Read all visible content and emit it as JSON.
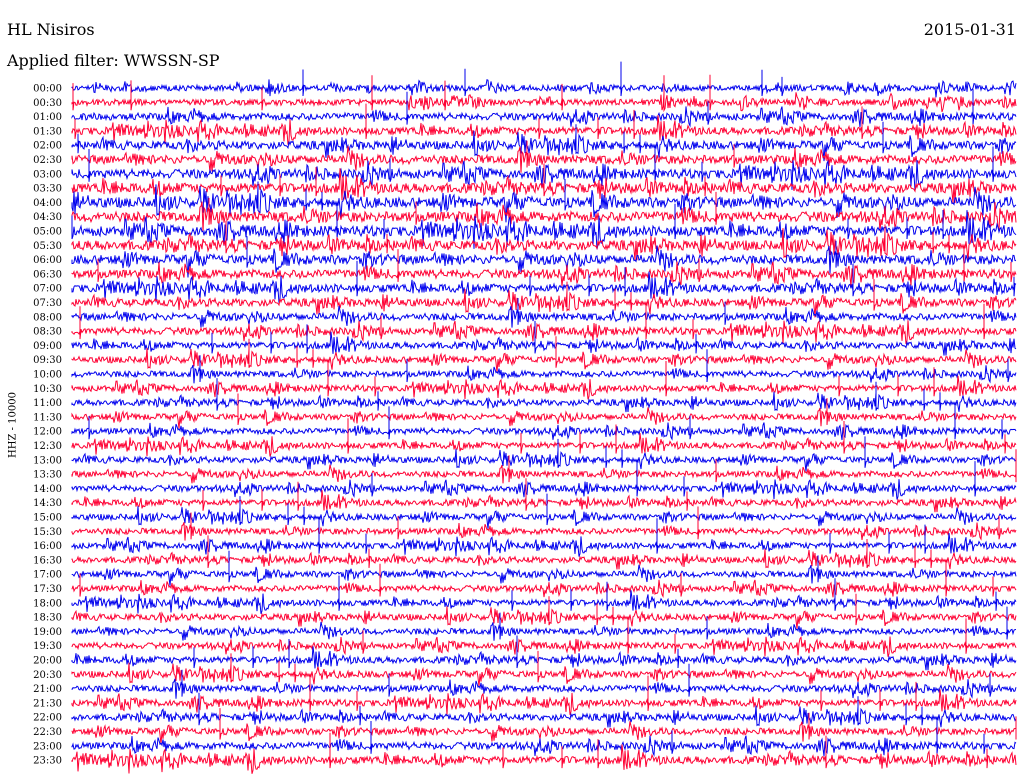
{
  "header": {
    "station": "HL Nisiros",
    "date": "2015-01-31",
    "filter_label": "Applied filter: WWSSN-SP"
  },
  "chart_data": {
    "type": "line",
    "title": "HL Nisiros",
    "subtitle": "Applied filter: WWSSN-SP",
    "ylabel": "HHZ - 10000",
    "xlabel": "",
    "grid": false,
    "row_labels": [
      "00:00",
      "00:30",
      "01:00",
      "01:30",
      "02:00",
      "02:30",
      "03:00",
      "03:30",
      "04:00",
      "04:30",
      "05:00",
      "05:30",
      "06:00",
      "06:30",
      "07:00",
      "07:30",
      "08:00",
      "08:30",
      "09:00",
      "09:30",
      "10:00",
      "10:30",
      "11:00",
      "11:30",
      "12:00",
      "12:30",
      "13:00",
      "13:30",
      "14:00",
      "14:30",
      "15:00",
      "15:30",
      "16:00",
      "16:30",
      "17:00",
      "17:30",
      "18:00",
      "18:30",
      "19:00",
      "19:30",
      "20:00",
      "20:30",
      "21:00",
      "21:30",
      "22:00",
      "22:30",
      "23:00",
      "23:30"
    ],
    "series_colors": [
      "#0000ee",
      "#ff0033"
    ],
    "noise_level": [
      0.55,
      0.6,
      0.7,
      0.75,
      0.8,
      0.85,
      0.9,
      0.95,
      1.0,
      1.0,
      1.0,
      0.95,
      0.9,
      0.85,
      0.8,
      0.75,
      0.7,
      0.7,
      0.65,
      0.65,
      0.6,
      0.6,
      0.6,
      0.6,
      0.6,
      0.6,
      0.6,
      0.6,
      0.6,
      0.6,
      0.6,
      0.6,
      0.6,
      0.6,
      0.6,
      0.6,
      0.6,
      0.6,
      0.6,
      0.6,
      0.65,
      0.65,
      0.65,
      0.65,
      0.65,
      0.65,
      0.7,
      0.75
    ]
  }
}
